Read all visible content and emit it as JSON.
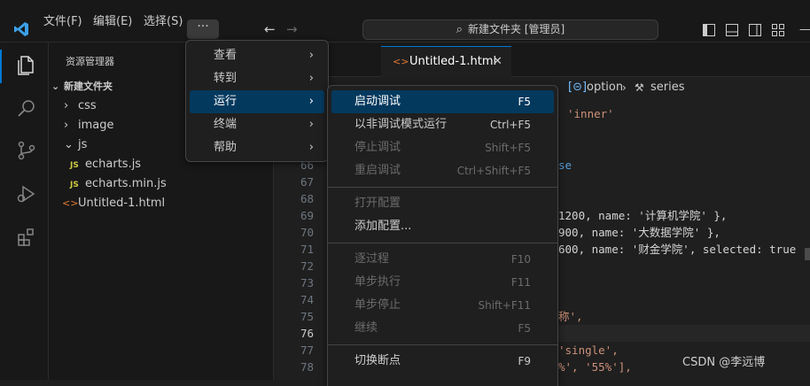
{
  "menubar": {
    "file": "文件(F)",
    "edit": "编辑(E)",
    "selection": "选择(S)",
    "more": "···"
  },
  "command_center": {
    "text": "新建文件夹 [管理员]"
  },
  "sidebar": {
    "title": "资源管理器",
    "folder": "新建文件夹",
    "items": [
      {
        "label": "css"
      },
      {
        "label": "image"
      },
      {
        "label": "js"
      },
      {
        "label": "echarts.js",
        "badge": "JS"
      },
      {
        "label": "echarts.min.js",
        "badge": "JS"
      },
      {
        "label": "Untitled-1.html"
      }
    ]
  },
  "editor": {
    "tab_label": "Untitled-1.html",
    "breadcrumb": {
      "option": "option",
      "series": "series"
    },
    "lines": [
      {
        "no": "66",
        "text": "se"
      },
      {
        "no": "67",
        "text": ""
      },
      {
        "no": "68",
        "text": ""
      },
      {
        "no": "69",
        "text": "1200, name: '计算机学院' },"
      },
      {
        "no": "70",
        "text": "900, name: '大数据学院' },"
      },
      {
        "no": "71",
        "text": "600, name: '财金学院', selected: true"
      },
      {
        "no": "72",
        "text": ""
      },
      {
        "no": "73",
        "text": ""
      },
      {
        "no": "74",
        "text": ""
      },
      {
        "no": "75",
        "text": "称',"
      },
      {
        "no": "76",
        "text": ""
      },
      {
        "no": "77",
        "text": "'single',"
      },
      {
        "no": "78",
        "text": "%', '55%'],"
      }
    ],
    "line_top": "'inner'"
  },
  "main_menu": {
    "items": [
      {
        "label": "查看"
      },
      {
        "label": "转到"
      },
      {
        "label": "运行"
      },
      {
        "label": "终端"
      },
      {
        "label": "帮助"
      }
    ]
  },
  "run_menu": {
    "items": [
      {
        "label": "启动调试",
        "key": "F5",
        "state": "selected"
      },
      {
        "label": "以非调试模式运行",
        "key": "Ctrl+F5",
        "state": "enabled"
      },
      {
        "label": "停止调试",
        "key": "Shift+F5",
        "state": "disabled"
      },
      {
        "label": "重启调试",
        "key": "Ctrl+Shift+F5",
        "state": "disabled"
      },
      {
        "label": "打开配置",
        "key": "",
        "state": "disabled"
      },
      {
        "label": "添加配置...",
        "key": "",
        "state": "enabled"
      },
      {
        "label": "逐过程",
        "key": "F10",
        "state": "disabled"
      },
      {
        "label": "单步执行",
        "key": "F11",
        "state": "disabled"
      },
      {
        "label": "单步停止",
        "key": "Shift+F11",
        "state": "disabled"
      },
      {
        "label": "继续",
        "key": "F5",
        "state": "disabled"
      },
      {
        "label": "切换断点",
        "key": "F9",
        "state": "enabled"
      }
    ]
  },
  "watermark": "CSDN @李远博",
  "colors": {
    "accent": "#0078d4",
    "selection": "#04395e",
    "js_badge": "#cbcb41",
    "html_icon": "#e37933"
  }
}
